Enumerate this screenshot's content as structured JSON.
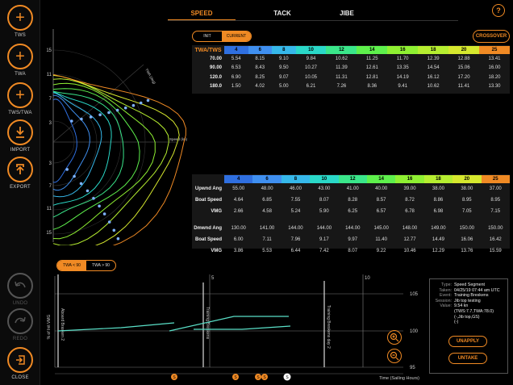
{
  "sidebar": {
    "tws_label": "TWS",
    "twa_label": "TWA",
    "twstwa_label": "TWS/TWA",
    "import_label": "IMPORT",
    "export_label": "EXPORT",
    "undo_label": "UNDO",
    "redo_label": "REDO",
    "close_label": "CLOSE"
  },
  "tabs": [
    {
      "label": "SPEED",
      "active": true
    },
    {
      "label": "TACK",
      "active": false
    },
    {
      "label": "JIBE",
      "active": false
    }
  ],
  "help_label": "?",
  "toggle": {
    "init": "INIT",
    "current": "CURRENT"
  },
  "crossover_label": "CROSSOVER",
  "polar": {
    "y_ticks": [
      "15",
      "11",
      "7",
      "3",
      "3",
      "7",
      "11",
      "15"
    ],
    "twa_vmg_label": "TWA (deg)",
    "speed_label": "Speed (kn)"
  },
  "tws_header": "TWA/TWS",
  "tws_values": [
    "4",
    "6",
    "8",
    "10",
    "12",
    "14",
    "16",
    "18",
    "20",
    "25"
  ],
  "tws_colors": [
    "#2f6fe0",
    "#3f8ff0",
    "#36b8ea",
    "#2ad8c8",
    "#3ae68a",
    "#5ef04c",
    "#8ff032",
    "#b6ee30",
    "#d6e82e",
    "#f08a24"
  ],
  "speed_rows": [
    {
      "label": "70.00",
      "values": [
        "5.54",
        "8.15",
        "9.10",
        "9.84",
        "10.62",
        "11.25",
        "11.70",
        "12.39",
        "12.88",
        "13.41"
      ]
    },
    {
      "label": "90.00",
      "values": [
        "6.53",
        "8.43",
        "9.50",
        "10.27",
        "11.39",
        "12.61",
        "13.35",
        "14.54",
        "15.06",
        "16.00"
      ]
    },
    {
      "label": "120.0",
      "values": [
        "6.90",
        "8.25",
        "9.07",
        "10.05",
        "11.31",
        "12.81",
        "14.19",
        "16.12",
        "17.20",
        "18.20"
      ]
    },
    {
      "label": "180.0",
      "values": [
        "1.50",
        "4.02",
        "5.00",
        "6.21",
        "7.26",
        "8.36",
        "9.41",
        "10.62",
        "11.41",
        "13.30"
      ]
    }
  ],
  "upwind_rows": [
    {
      "label": "Upwnd Ang",
      "values": [
        "55.00",
        "48.00",
        "46.00",
        "43.00",
        "41.00",
        "40.00",
        "39.00",
        "38.00",
        "38.00",
        "37.00"
      ]
    },
    {
      "label": "Boat Speed",
      "values": [
        "4.64",
        "6.85",
        "7.55",
        "8.07",
        "8.28",
        "8.57",
        "8.72",
        "8.86",
        "8.95",
        "8.95"
      ]
    },
    {
      "label": "VMG",
      "values": [
        "2.66",
        "4.58",
        "5.24",
        "5.90",
        "6.25",
        "6.57",
        "6.78",
        "6.98",
        "7.05",
        "7.15"
      ]
    }
  ],
  "downwind_rows": [
    {
      "label": "Dmwnd Ang",
      "values": [
        "130.00",
        "141.00",
        "144.00",
        "144.00",
        "144.00",
        "145.00",
        "148.00",
        "149.00",
        "150.00",
        "150.00"
      ]
    },
    {
      "label": "Boat Speed",
      "values": [
        "6.00",
        "7.11",
        "7.96",
        "9.17",
        "9.97",
        "11.40",
        "12.77",
        "14.49",
        "16.06",
        "16.42"
      ]
    },
    {
      "label": "VMG",
      "values": [
        "3.86",
        "5.53",
        "6.44",
        "7.42",
        "8.07",
        "9.22",
        "10.46",
        "12.29",
        "13.76",
        "15.59"
      ]
    }
  ],
  "segment_toggle": {
    "left": "TWA < 90",
    "right": "TWA > 90"
  },
  "timeline": {
    "ylabel": "% of Init VMG",
    "xlabel": "Time (Sailing Hours)",
    "y_ticks": [
      "105",
      "100",
      "95"
    ],
    "x_ticks": [
      "5",
      "10"
    ],
    "event_1": "Aboard Brasken 2",
    "event_2": "Training Breskens",
    "event_3": "Training Breskens day 2",
    "marker": "S"
  },
  "info": {
    "type_key": "Type:",
    "type_val": "Speed Segment",
    "taken_key": "Taken:",
    "taken_val": "04/25/19 07:44 am UTC",
    "event_key": "Event:",
    "event_val": "Training Breskens",
    "session_key": "Session:",
    "session_val": "Jib top testing",
    "value_key": "Value:",
    "value_val": "9.54 kn",
    "line2": "(TWS:7.7,TWA:78.0)",
    "line3": "(-,Jib top,GS)",
    "line4": "(-)"
  },
  "unapply_label": "UNAPPLY",
  "untake_label": "UNTAKE"
}
